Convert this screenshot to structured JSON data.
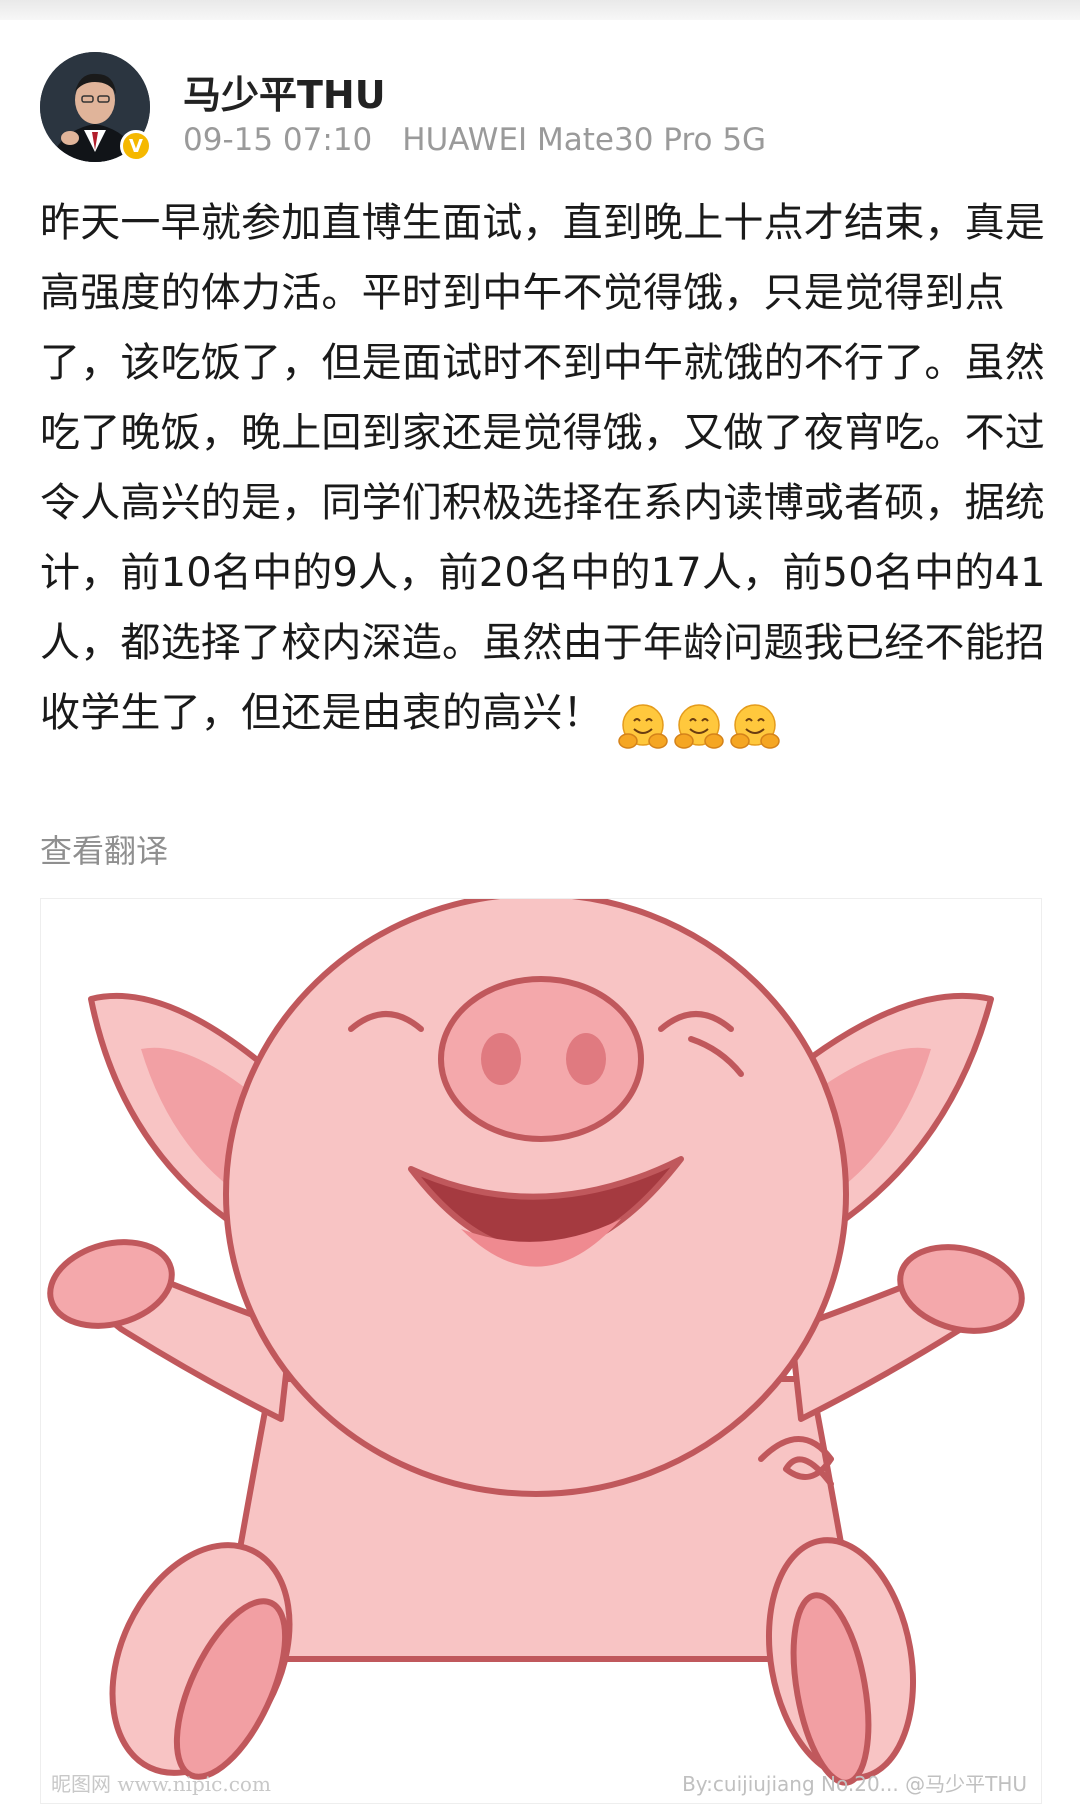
{
  "post": {
    "username": "马少平THU",
    "timestamp": "09-15 07:10",
    "device": "HUAWEI Mate30 Pro 5G",
    "body": "昨天一早就参加直博生面试，直到晚上十点才结束，真是高强度的体力活。平时到中午不觉得饿，只是觉得到点了，该吃饭了，但是面试时不到中午就饿的不行了。虽然吃了晚饭，晚上回到家还是觉得饿，又做了夜宵吃。不过令人高兴的是，同学们积极选择在系内读博或者硕，据统计，前10名中的9人，前20名中的17人，前50名中的41人，都选择了校内深造。虽然由于年龄问题我已经不能招收学生了，但还是由衷的高兴！",
    "emojis": [
      "hug-emoji",
      "hug-emoji",
      "hug-emoji"
    ],
    "translate_label": "查看翻译",
    "verified_badge": "V",
    "image": {
      "subject": "cartoon-pig",
      "watermark_left": "昵图网 www.nipic.com",
      "watermark_right": "By:cuijiujiang No.20... @马少平THU"
    }
  },
  "colors": {
    "username": "#222222",
    "meta": "#9a9a9a",
    "body_text": "#1a1a1a",
    "translate": "#8f8f8f",
    "badge": "#f5b800",
    "pig_fill": "#f8c4c4",
    "pig_outline": "#c0585c"
  }
}
